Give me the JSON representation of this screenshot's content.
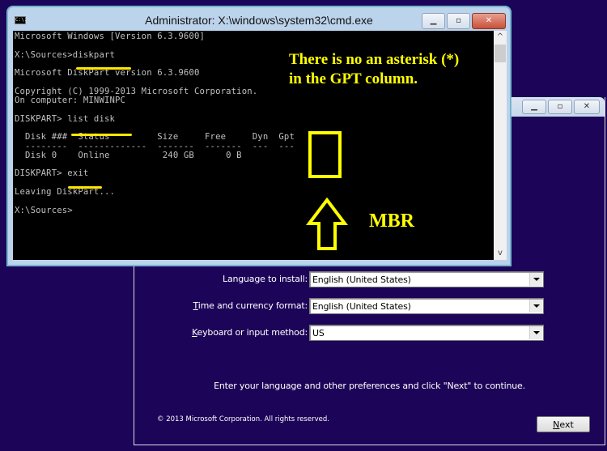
{
  "setup_window": {
    "title_buttons": [
      "minimize",
      "maximize",
      "close"
    ],
    "fields": [
      {
        "label_pre": "Langua",
        "label_access": "g",
        "label_post": "e to install:",
        "value": "English (United States)"
      },
      {
        "label_pre": "",
        "label_access": "T",
        "label_post": "ime and currency format:",
        "value": "English (United States)"
      },
      {
        "label_pre": "",
        "label_access": "K",
        "label_post": "eyboard or input method:",
        "value": "US"
      }
    ],
    "instruction": "Enter your language and other preferences and click \"Next\" to continue.",
    "copyright": "© 2013 Microsoft Corporation. All rights reserved.",
    "next_button": {
      "access": "N",
      "rest": "ext"
    }
  },
  "cmd_window": {
    "icon_text": "C:\\.",
    "title": "Administrator: X:\\windows\\system32\\cmd.exe",
    "console_lines": [
      "Microsoft Windows [Version 6.3.9600]",
      "",
      "X:\\Sources>diskpart",
      "",
      "Microsoft DiskPart version 6.3.9600",
      "",
      "Copyright (C) 1999-2013 Microsoft Corporation.",
      "On computer: MINWINPC",
      "",
      "DISKPART> list disk",
      "",
      "  Disk ###  Status         Size     Free     Dyn  Gpt",
      "  --------  -------------  -------  -------  ---  ---",
      "  Disk 0    Online          240 GB      0 B",
      "",
      "DISKPART> exit",
      "",
      "Leaving DiskPart...",
      "",
      "X:\\Sources>"
    ],
    "scroll_up": "^",
    "scroll_down": "v"
  },
  "annotations": {
    "note_line1": "There is no an asterisk (*)",
    "note_line2": "in the GPT column.",
    "mbr_label": "MBR",
    "highlight_color": "#ffff00"
  }
}
